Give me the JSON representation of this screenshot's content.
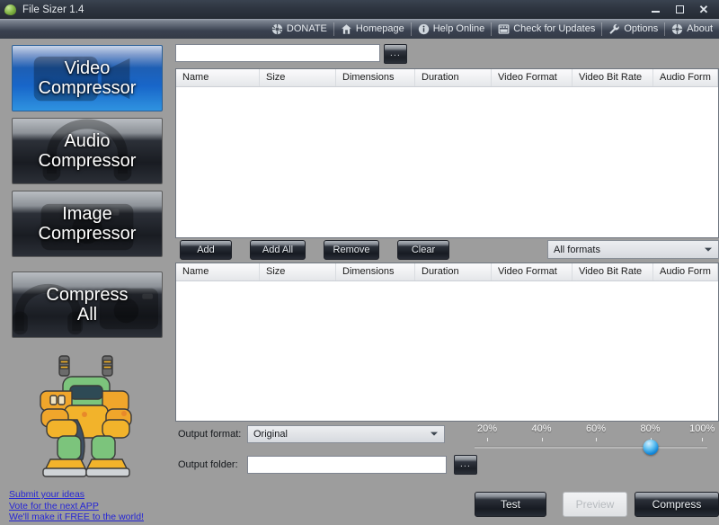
{
  "window": {
    "title": "File Sizer 1.4",
    "icon": "leaf-icon",
    "controls": {
      "minimize": "minimize-icon",
      "maximize": "maximize-icon",
      "close": "close-icon"
    }
  },
  "toolbar": {
    "items": [
      {
        "label": "DONATE",
        "icon": "donate-icon"
      },
      {
        "label": "Homepage",
        "icon": "home-icon"
      },
      {
        "label": "Help Online",
        "icon": "info-icon"
      },
      {
        "label": "Check for Updates",
        "icon": "update-icon"
      },
      {
        "label": "Options",
        "icon": "wrench-icon"
      },
      {
        "label": "About",
        "icon": "about-icon"
      }
    ]
  },
  "sidebar": {
    "buttons": [
      {
        "line1": "Video",
        "line2": "Compressor",
        "selected": true,
        "glyph": "video-camera-glyph"
      },
      {
        "line1": "Audio",
        "line2": "Compressor",
        "selected": false,
        "glyph": "headphones-glyph"
      },
      {
        "line1": "Image",
        "line2": "Compressor",
        "selected": false,
        "glyph": "camera-glyph"
      },
      {
        "line1": "Compress",
        "line2": "All",
        "selected": false,
        "glyph": "all-media-glyph"
      }
    ],
    "mascot": "robot-mascot",
    "links": [
      "Submit your ideas",
      "Vote for the next APP",
      "We'll make it FREE to the world!"
    ],
    "link_color": "#2626d6"
  },
  "main": {
    "search": {
      "value": "",
      "placeholder": ""
    },
    "browse_button_label": "...",
    "columns": [
      "Name",
      "Size",
      "Dimensions",
      "Duration",
      "Video Format",
      "Video Bit Rate",
      "Audio Form"
    ],
    "source_list": {
      "rows": []
    },
    "target_list": {
      "rows": []
    },
    "actions": [
      {
        "label": "Add"
      },
      {
        "label": "Add All"
      },
      {
        "label": "Remove"
      },
      {
        "label": "Clear"
      }
    ],
    "format_filter": {
      "value": "All formats"
    },
    "output_format": {
      "label": "Output format:",
      "value": "Original"
    },
    "output_folder": {
      "label": "Output folder:",
      "value": "",
      "placeholder": ""
    },
    "quality_slider": {
      "ticks": [
        "20%",
        "40%",
        "60%",
        "80%",
        "100%"
      ],
      "value": 80,
      "min": 10,
      "max": 100
    },
    "footer_buttons": [
      {
        "label": "Test",
        "state": "enabled"
      },
      {
        "label": "Preview",
        "state": "disabled"
      },
      {
        "label": "Compress",
        "state": "enabled"
      }
    ]
  },
  "colors": {
    "panel_bg": "#9d9d9d",
    "titlebar": "#2e3540",
    "accent_selected": "#1866c9",
    "slider_thumb": "#1387d8",
    "list_bg": "#ffffff"
  }
}
